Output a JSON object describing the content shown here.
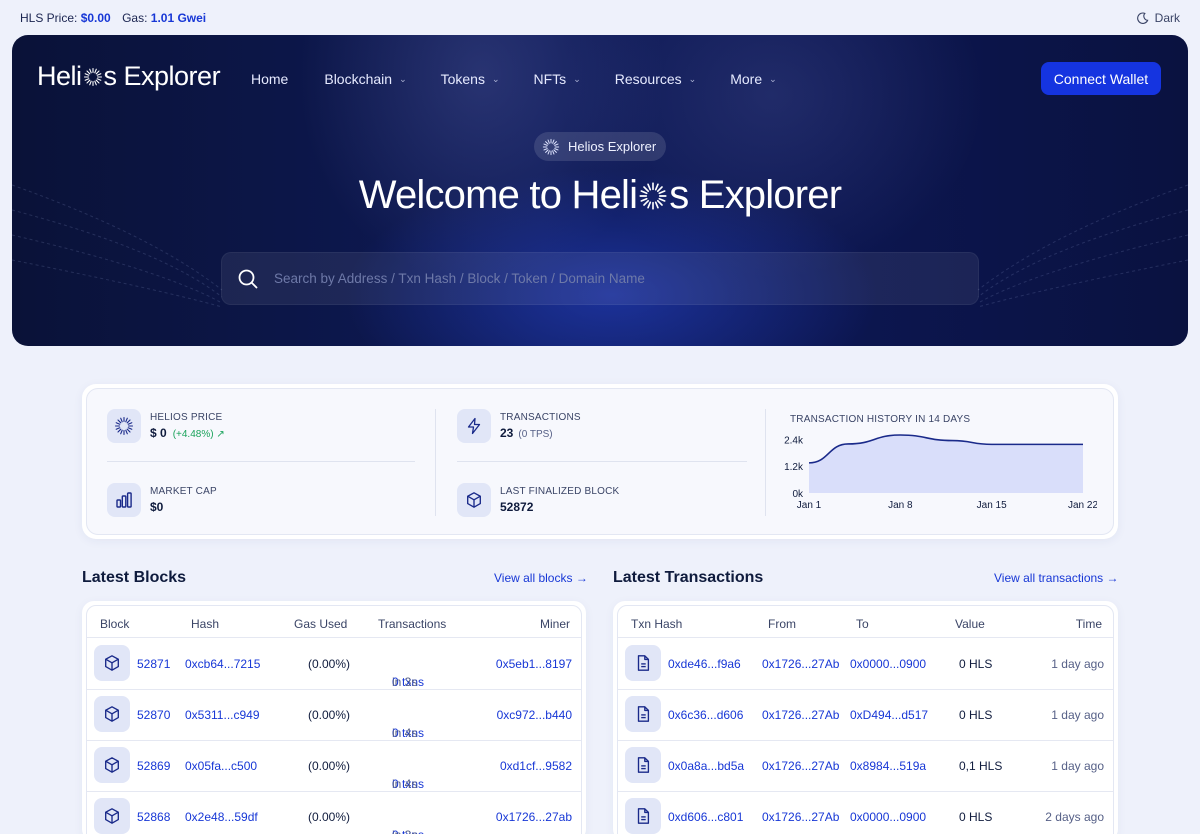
{
  "topbar": {
    "price_label": "HLS Price:",
    "price_value": "$0.00",
    "gas_label": "Gas:",
    "gas_value": "1.01 Gwei",
    "theme_label": "Dark",
    "theme_icon": "moon-icon"
  },
  "header": {
    "logo_left": "Heli",
    "logo_right": "s Explorer",
    "nav": [
      {
        "label": "Home"
      },
      {
        "label": "Blockchain"
      },
      {
        "label": "Tokens"
      },
      {
        "label": "NFTs"
      },
      {
        "label": "Resources"
      },
      {
        "label": "More"
      }
    ],
    "connect_label": "Connect Wallet"
  },
  "hero": {
    "pill_label": "Helios Explorer",
    "title_left": "Welcome to Heli",
    "title_right": "s Explorer",
    "search_placeholder": "Search by Address / Txn Hash / Block / Token / Domain Name"
  },
  "stats": {
    "price": {
      "label": "HELIOS PRICE",
      "value": "$ 0",
      "change": "(+4.48%) ↗"
    },
    "market_cap": {
      "label": "MARKET CAP",
      "value": "$0"
    },
    "transactions": {
      "label": "TRANSACTIONS",
      "value": "23",
      "tps": "(0 TPS)"
    },
    "last_block": {
      "label": "LAST FINALIZED BLOCK",
      "value": "52872"
    }
  },
  "chart_data": {
    "type": "area",
    "title": "TRANSACTION HISTORY IN 14 DAYS",
    "x_ticks": [
      "Jan 1",
      "Jan 8",
      "Jan 15",
      "Jan 22"
    ],
    "y_ticks": [
      "0k",
      "1.2k",
      "2.4k"
    ],
    "ylim": [
      0,
      2600
    ],
    "x": [
      1,
      4,
      8,
      12,
      15,
      19,
      22
    ],
    "values": [
      1350,
      2200,
      2600,
      2350,
      2180,
      2180,
      2180
    ],
    "fill": "#d9defa",
    "line": "#1a2a8a"
  },
  "blocks": {
    "title": "Latest Blocks",
    "view_all": "View all blocks →",
    "columns": [
      "Block",
      "Hash",
      "Gas Used",
      "Transactions",
      "Miner"
    ],
    "rows": [
      {
        "block": "52871",
        "hash": "0xcb64...7215",
        "gas": "(0.00%)",
        "txns": "0 txns",
        "age": "in 3s",
        "miner": "0x5eb1...8197"
      },
      {
        "block": "52870",
        "hash": "0x5311...c949",
        "gas": "(0.00%)",
        "txns": "0 txns",
        "age": "in 4s",
        "miner": "0xc972...b440"
      },
      {
        "block": "52869",
        "hash": "0x05fa...c500",
        "gas": "(0.00%)",
        "txns": "0 txns",
        "age": "in 4s",
        "miner": "0xd1cf...9582"
      },
      {
        "block": "52868",
        "hash": "0x2e48...59df",
        "gas": "(0.00%)",
        "txns": "0 txns",
        "age": "in 3s",
        "miner": "0x1726...27ab"
      }
    ]
  },
  "transactions": {
    "title": "Latest Transactions",
    "view_all": "View all transactions →",
    "columns": [
      "Txn Hash",
      "From",
      "To",
      "Value",
      "Time"
    ],
    "rows": [
      {
        "hash": "0xde46...f9a6",
        "from": "0x1726...27Ab",
        "to": "0x0000...0900",
        "value": "0 HLS",
        "time": "1 day ago"
      },
      {
        "hash": "0x6c36...d606",
        "from": "0x1726...27Ab",
        "to": "0xD494...d517",
        "value": "0 HLS",
        "time": "1 day ago"
      },
      {
        "hash": "0x0a8a...bd5a",
        "from": "0x1726...27Ab",
        "to": "0x8984...519a",
        "value": "0,1 HLS",
        "time": "1 day ago"
      },
      {
        "hash": "0xd606...c801",
        "from": "0x1726...27Ab",
        "to": "0x0000...0900",
        "value": "0 HLS",
        "time": "2 days ago"
      }
    ]
  }
}
